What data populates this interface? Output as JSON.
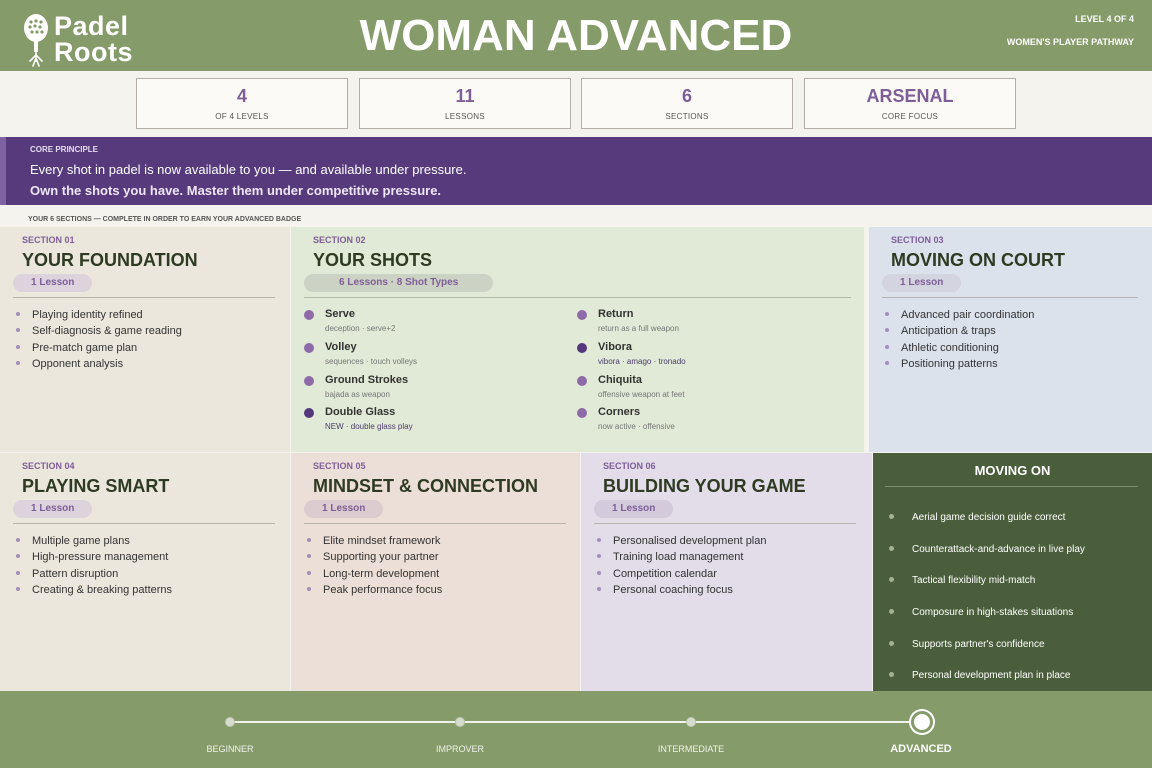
{
  "header": {
    "logo_line1": "Padel",
    "logo_line2": "Roots",
    "title": "WOMAN ADVANCED",
    "level_tag": "LEVEL 4 OF 4",
    "pathway_tag": "WOMEN'S PLAYER PATHWAY"
  },
  "stats": [
    {
      "value": "4",
      "label": "OF 4 LEVELS"
    },
    {
      "value": "11",
      "label": "LESSONS"
    },
    {
      "value": "6",
      "label": "SECTIONS"
    },
    {
      "value": "ARSENAL",
      "label": "CORE FOCUS"
    }
  ],
  "principle": {
    "label": "CORE PRINCIPLE",
    "line1": "Every shot in padel is now available to you — and available under pressure.",
    "line2": "Own the shots you have. Master them under competitive pressure."
  },
  "sections_label": "YOUR 6 SECTIONS — COMPLETE IN ORDER TO EARN YOUR ADVANCED BADGE",
  "sections": [
    {
      "num": "SECTION 01",
      "title": "YOUR FOUNDATION",
      "pill": "1 Lesson",
      "items": [
        "Playing identity refined",
        "Self-diagnosis & game reading",
        "Pre-match game plan",
        "Opponent analysis"
      ]
    },
    {
      "num": "SECTION 02",
      "title": "YOUR SHOTS",
      "pill": "6 Lessons · 8 Shot Types",
      "shots": [
        {
          "name": "Serve",
          "desc": "deception · serve+2"
        },
        {
          "name": "Return",
          "desc": "return as a full weapon"
        },
        {
          "name": "Volley",
          "desc": "sequences · touch volleys"
        },
        {
          "name": "Vibora",
          "desc": "vibora · amago · tronado"
        },
        {
          "name": "Ground Strokes",
          "desc": "bajada as weapon"
        },
        {
          "name": "Chiquita",
          "desc": "offensive weapon at feet"
        },
        {
          "name": "Double Glass",
          "desc": "NEW · double glass play"
        },
        {
          "name": "Corners",
          "desc": "now active · offensive"
        }
      ]
    },
    {
      "num": "SECTION 03",
      "title": "MOVING ON COURT",
      "pill": "1 Lesson",
      "items": [
        "Advanced pair coordination",
        "Anticipation & traps",
        "Athletic conditioning",
        "Positioning patterns"
      ]
    },
    {
      "num": "SECTION 04",
      "title": "PLAYING SMART",
      "pill": "1 Lesson",
      "items": [
        "Multiple game plans",
        "High-pressure management",
        "Pattern disruption",
        "Creating & breaking patterns"
      ]
    },
    {
      "num": "SECTION 05",
      "title": "MINDSET & CONNECTION",
      "pill": "1 Lesson",
      "items": [
        "Elite mindset framework",
        "Supporting your partner",
        "Long-term development",
        "Peak performance focus"
      ]
    },
    {
      "num": "SECTION 06",
      "title": "BUILDING YOUR GAME",
      "pill": "1 Lesson",
      "items": [
        "Personalised development plan",
        "Training load management",
        "Competition calendar",
        "Personal coaching focus"
      ]
    }
  ],
  "moving_on": {
    "title": "MOVING ON",
    "items": [
      "Aerial game decision guide correct",
      "Counterattack-and-advance in live play",
      "Tactical flexibility mid-match",
      "Composure in high-stakes situations",
      "Supports partner's confidence",
      "Personal development plan in place"
    ]
  },
  "pathway": {
    "stages": [
      "BEGINNER",
      "IMPROVER",
      "INTERMEDIATE",
      "ADVANCED"
    ],
    "current_stage": 4
  },
  "colors": {
    "brand_green": "#859b69",
    "dark_green": "#4b5e3c",
    "purple": "#563a7c",
    "accent_purple": "#7e5e97"
  }
}
